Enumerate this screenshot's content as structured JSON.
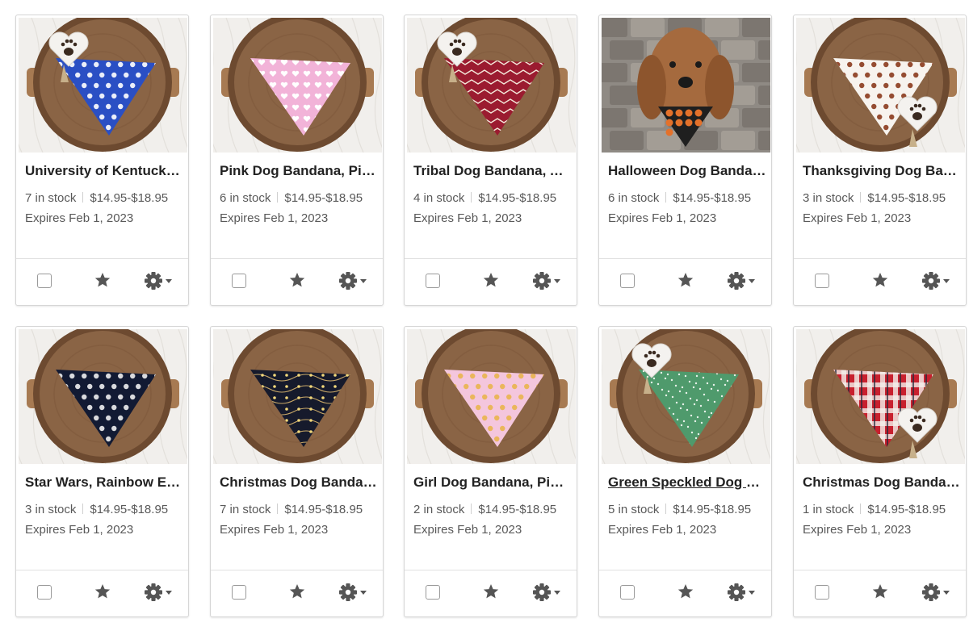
{
  "listings": [
    {
      "title": "University of Kentucky Dog Bandana, Over the Collar",
      "stock": "7 in stock",
      "price": "$14.95-$18.95",
      "expires": "Expires Feb 1, 2023",
      "link": false,
      "image": {
        "bandana": "#2a4fc4",
        "accent": "#ffffff",
        "tag": true,
        "tagSide": "left",
        "dog": false,
        "pattern": "logo"
      }
    },
    {
      "title": "Pink Dog Bandana, Pink Hearts",
      "stock": "6 in stock",
      "price": "$14.95-$18.95",
      "expires": "Expires Feb 1, 2023",
      "link": false,
      "image": {
        "bandana": "#f2b3d8",
        "accent": "#ffffff",
        "tag": false,
        "dog": false,
        "pattern": "hearts"
      }
    },
    {
      "title": "Tribal Dog Bandana, Aztec",
      "stock": "4 in stock",
      "price": "$14.95-$18.95",
      "expires": "Expires Feb 1, 2023",
      "link": false,
      "image": {
        "bandana": "#9b1b30",
        "accent": "#f3e6d8",
        "tag": true,
        "tagSide": "left",
        "dog": false,
        "pattern": "tribal"
      }
    },
    {
      "title": "Halloween Dog Bandana, Pumpkins",
      "stock": "6 in stock",
      "price": "$14.95-$18.95",
      "expires": "Expires Feb 1, 2023",
      "link": false,
      "image": {
        "bandana": "#1f1f1f",
        "accent": "#e4712a",
        "tag": false,
        "dog": true,
        "pattern": "dots"
      }
    },
    {
      "title": "Thanksgiving Dog Bandana, Turkeys",
      "stock": "3 in stock",
      "price": "$14.95-$18.95",
      "expires": "Expires Feb 1, 2023",
      "link": false,
      "image": {
        "bandana": "#f7f3ee",
        "accent": "#8a3a1c",
        "tag": true,
        "tagSide": "right",
        "dog": false,
        "pattern": "turkeys"
      }
    },
    {
      "title": "Star Wars, Rainbow Edition Dog Bandana",
      "stock": "3 in stock",
      "price": "$14.95-$18.95",
      "expires": "Expires Feb 1, 2023",
      "link": false,
      "image": {
        "bandana": "#121a33",
        "accent": "#f0f0f0",
        "tag": false,
        "dog": false,
        "pattern": "dots"
      }
    },
    {
      "title": "Christmas Dog Bandana, Lights",
      "stock": "7 in stock",
      "price": "$14.95-$18.95",
      "expires": "Expires Feb 1, 2023",
      "link": false,
      "image": {
        "bandana": "#161a2c",
        "accent": "#f1d77a",
        "tag": false,
        "dog": false,
        "pattern": "lights"
      }
    },
    {
      "title": "Girl Dog Bandana, Pink Cupcakes",
      "stock": "2 in stock",
      "price": "$14.95-$18.95",
      "expires": "Expires Feb 1, 2023",
      "link": false,
      "image": {
        "bandana": "#f4c6dd",
        "accent": "#e9b44c",
        "tag": false,
        "dog": false,
        "pattern": "dots"
      }
    },
    {
      "title": "Green Speckled Dog Bandana",
      "stock": "5 in stock",
      "price": "$14.95-$18.95",
      "expires": "Expires Feb 1, 2023",
      "link": true,
      "image": {
        "bandana": "#4f9a6c",
        "accent": "#e8f2ea",
        "tag": true,
        "tagSide": "left",
        "dog": false,
        "pattern": "speckle"
      }
    },
    {
      "title": "Christmas Dog Bandana, Plaid",
      "stock": "1 in stock",
      "price": "$14.95-$18.95",
      "expires": "Expires Feb 1, 2023",
      "link": false,
      "image": {
        "bandana": "#c8202e",
        "accent": "#f4f1ec",
        "tag": true,
        "tagSide": "right",
        "dog": false,
        "pattern": "plaid"
      }
    }
  ],
  "colors": {
    "tray_wood": "#8a6445",
    "tray_rim": "#6d4a30",
    "background_quilt": "#f1efec",
    "icon": "#555555"
  }
}
